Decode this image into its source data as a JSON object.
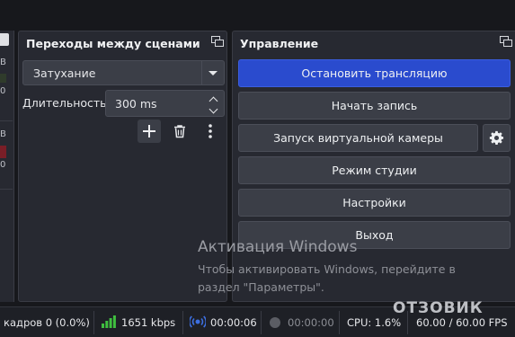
{
  "mixer_edge": {
    "label_b1": "B",
    "label_0a": "0",
    "label_b2": "B",
    "label_0b": "0"
  },
  "transitions_panel": {
    "title": "Переходы между сценами",
    "transition_select": {
      "value": "Затухание"
    },
    "duration": {
      "label": "Длительность",
      "value": "300 ms"
    },
    "toolbar": {
      "add": "add-icon",
      "remove": "trash-icon",
      "menu": "more-vertical-icon"
    }
  },
  "controls_panel": {
    "title": "Управление",
    "buttons": {
      "stop_stream": "Остановить трансляцию",
      "start_recording": "Начать запись",
      "start_virtualcam": "Запуск виртуальной камеры",
      "studio_mode": "Режим студии",
      "settings": "Настройки",
      "exit": "Выход"
    },
    "virtualcam_settings_icon": "gear-icon",
    "primary_color": "#2a4bce"
  },
  "watermark": {
    "title": "Активация Windows",
    "line1": "Чтобы активировать Windows, перейдите в",
    "line2": "раздел \"Параметры\".",
    "site": "ОТЗОВИК"
  },
  "statusbar": {
    "dropped_frames": "кадров 0 (0.0%)",
    "bitrate": "1651 kbps",
    "stream_time": "00:00:06",
    "record_time": "00:00:00",
    "cpu": "CPU: 1.6%",
    "fps": "60.00 / 60.00 FPS",
    "accent_green": "#3fbf3f",
    "accent_blue": "#3d6fe0"
  }
}
